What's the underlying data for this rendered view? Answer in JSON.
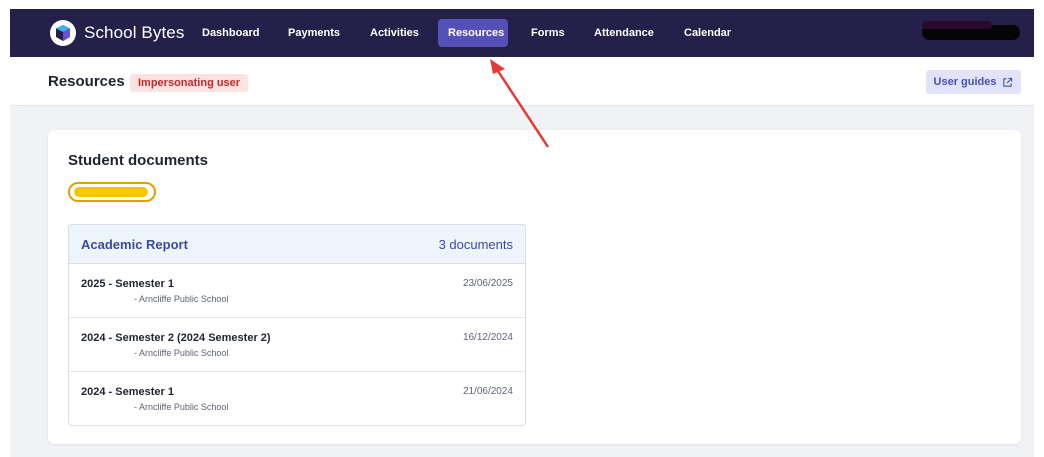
{
  "navbar": {
    "brand": "School Bytes",
    "items": [
      {
        "label": "Dashboard",
        "active": false
      },
      {
        "label": "Payments",
        "active": false
      },
      {
        "label": "Activities",
        "active": false
      },
      {
        "label": "Resources",
        "active": true
      },
      {
        "label": "Forms",
        "active": false
      },
      {
        "label": "Attendance",
        "active": false
      },
      {
        "label": "Calendar",
        "active": false
      }
    ]
  },
  "header": {
    "title": "Resources",
    "badge": "Impersonating user",
    "user_guides_label": "User guides"
  },
  "student_documents": {
    "title": "Student documents",
    "panel": {
      "title": "Academic Report",
      "count": "3 documents",
      "documents": [
        {
          "name": "2025 - Semester 1",
          "school": "- Arncliffe Public School",
          "date": "23/06/2025"
        },
        {
          "name": "2024 - Semester 2 (2024 Semester 2)",
          "school": "- Arncliffe Public School",
          "date": "16/12/2024"
        },
        {
          "name": "2024 - Semester 1",
          "school": "- Arncliffe Public School",
          "date": "21/06/2024"
        }
      ]
    }
  },
  "colors": {
    "navbar": "#24204a",
    "nav_active": "#5450b8",
    "accent": "#3a4aa8",
    "badge_bg": "#fde2e2",
    "badge_text": "#c62828",
    "annotation_arrow": "#e53935"
  },
  "icons": {
    "brand": "school-bytes-logo-icon",
    "user_guides": "external-link-icon"
  }
}
